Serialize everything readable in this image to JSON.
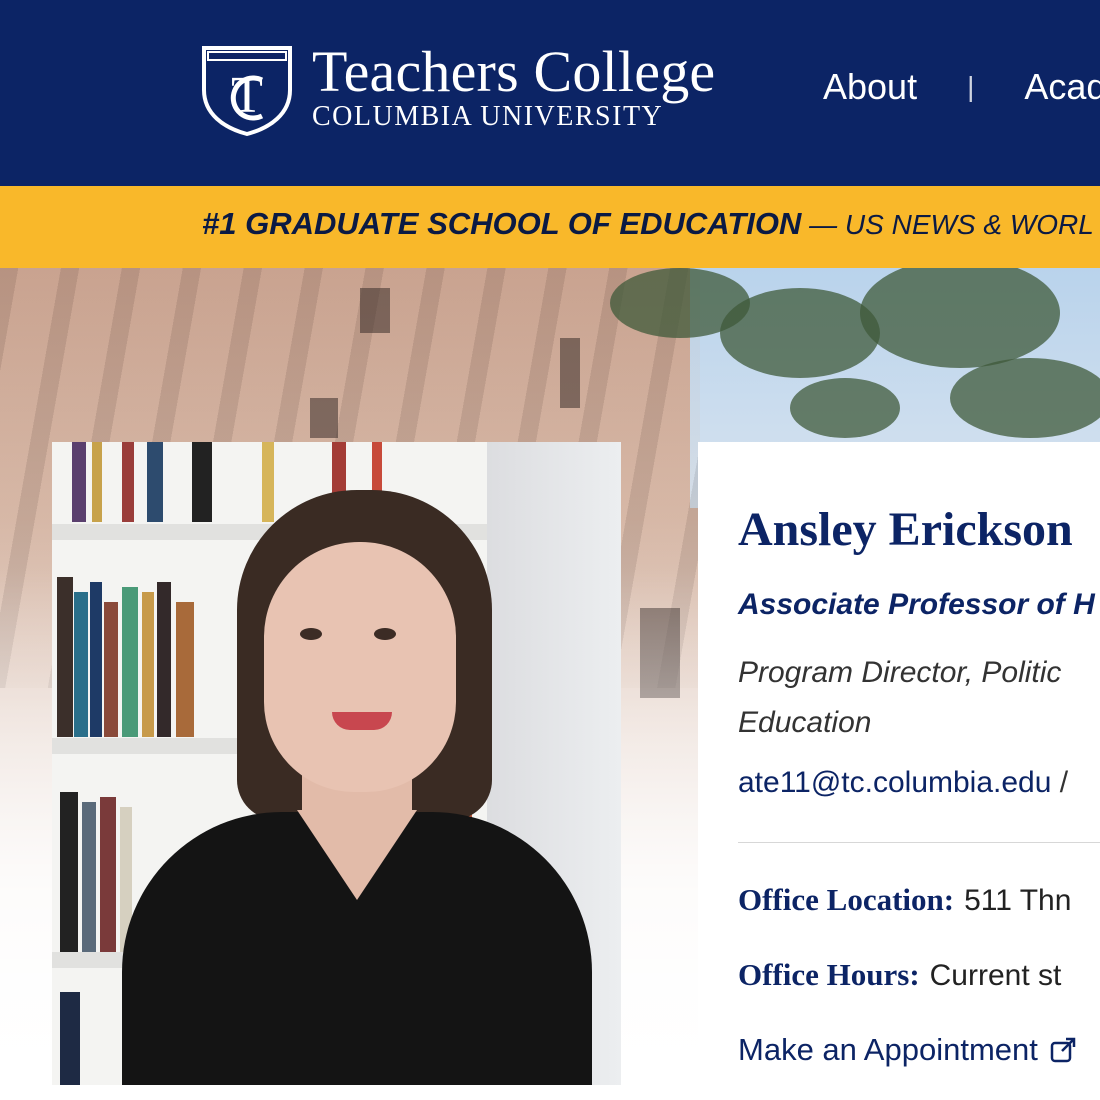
{
  "header": {
    "logo_title": "Teachers College",
    "logo_subtitle": "COLUMBIA UNIVERSITY",
    "nav": [
      {
        "label": "About"
      },
      {
        "label": "Acad"
      }
    ],
    "nav_separator": "|"
  },
  "banner": {
    "bold_text": "#1 GRADUATE SCHOOL OF EDUCATION",
    "rest_text": " — US NEWS & WORL"
  },
  "profile": {
    "photo_alt": "Portrait of Ansley Erickson",
    "name": "Ansley Erickson",
    "title": "Associate Professor of H",
    "subtitle_line1": "Program Director, Politic",
    "subtitle_line2": "Education",
    "email": "ate11@tc.columbia.edu",
    "email_sep": " /",
    "office_location_label": "Office Location:",
    "office_location_value": "511 Thn",
    "office_hours_label": "Office Hours:",
    "office_hours_value": "Current st",
    "appointment_label": "Make an Appointment"
  },
  "colors": {
    "navy": "#0c2465",
    "gold": "#f9b82a"
  },
  "icons": {
    "logo": "tc-shield-icon",
    "appointment": "external-link-icon"
  }
}
